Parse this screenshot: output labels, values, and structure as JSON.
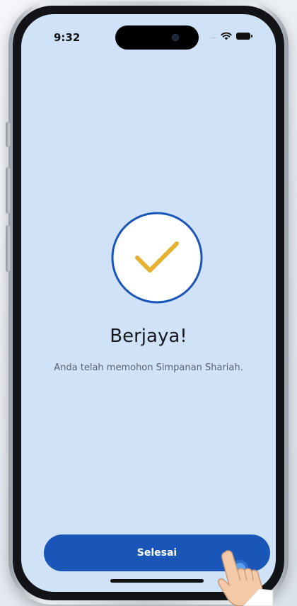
{
  "status_bar": {
    "time": "9:32",
    "signal": "....",
    "icons": [
      "wifi-icon",
      "battery-icon"
    ]
  },
  "result": {
    "title": "Berjaya!",
    "message": "Anda telah memohon Simpanan Shariah.",
    "icon": "checkmark-icon"
  },
  "actions": {
    "done_label": "Selesai"
  },
  "colors": {
    "screen_background": "#cfe2f7",
    "primary": "#1a55b8",
    "check": "#e5b12f",
    "circle_border": "#1a55b8",
    "circle_fill": "#ffffff"
  }
}
